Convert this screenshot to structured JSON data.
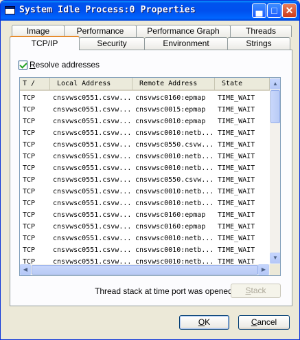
{
  "window": {
    "title": "System Idle Process:0 Properties"
  },
  "tabs_row1": [
    "Image",
    "Performance",
    "Performance Graph",
    "Threads"
  ],
  "tabs_row2": [
    "TCP/IP",
    "Security",
    "Environment",
    "Strings"
  ],
  "active_tab": "TCP/IP",
  "resolve": {
    "label": "Resolve addresses",
    "checked": true
  },
  "table": {
    "columns": [
      "T ∕",
      "Local Address",
      "Remote Address",
      "State"
    ],
    "rows": [
      [
        "TCP",
        "cnsvwsc0551.csvw...",
        "cnsvwsc0160:epmap",
        "TIME_WAIT"
      ],
      [
        "TCP",
        "cnsvwsc0551.csvw...",
        "cnsvwsc0015:epmap",
        "TIME_WAIT"
      ],
      [
        "TCP",
        "cnsvwsc0551.csvw...",
        "cnsvwsc0010:epmap",
        "TIME_WAIT"
      ],
      [
        "TCP",
        "cnsvwsc0551.csvw...",
        "cnsvwsc0010:netb...",
        "TIME_WAIT"
      ],
      [
        "TCP",
        "cnsvwsc0551.csvw...",
        "cnsvwsc0550.csvw...",
        "TIME_WAIT"
      ],
      [
        "TCP",
        "cnsvwsc0551.csvw...",
        "cnsvwsc0010:netb...",
        "TIME_WAIT"
      ],
      [
        "TCP",
        "cnsvwsc0551.csvw...",
        "cnsvwsc0010:netb...",
        "TIME_WAIT"
      ],
      [
        "TCP",
        "cnsvwsc0551.csvw...",
        "cnsvwsc0550.csvw...",
        "TIME_WAIT"
      ],
      [
        "TCP",
        "cnsvwsc0551.csvw...",
        "cnsvwsc0010:netb...",
        "TIME_WAIT"
      ],
      [
        "TCP",
        "cnsvwsc0551.csvw...",
        "cnsvwsc0010:netb...",
        "TIME_WAIT"
      ],
      [
        "TCP",
        "cnsvwsc0551.csvw...",
        "cnsvwsc0160:epmap",
        "TIME_WAIT"
      ],
      [
        "TCP",
        "cnsvwsc0551.csvw...",
        "cnsvwsc0160:epmap",
        "TIME_WAIT"
      ],
      [
        "TCP",
        "cnsvwsc0551.csvw...",
        "cnsvwsc0010:netb...",
        "TIME_WAIT"
      ],
      [
        "TCP",
        "cnsvwsc0551.csvw...",
        "cnsvwsc0010:netb...",
        "TIME_WAIT"
      ],
      [
        "TCP",
        "cnsvwsc0551.csvw...",
        "cnsvwsc0010:netb...",
        "TIME_WAIT"
      ]
    ]
  },
  "stack": {
    "caption": "Thread stack at time port was opened",
    "button": "Stack"
  },
  "footer": {
    "ok": "OK",
    "cancel": "Cancel"
  },
  "icons": {
    "minimize": "minimize-icon",
    "maximize": "maximize-icon",
    "close": "close-icon"
  }
}
